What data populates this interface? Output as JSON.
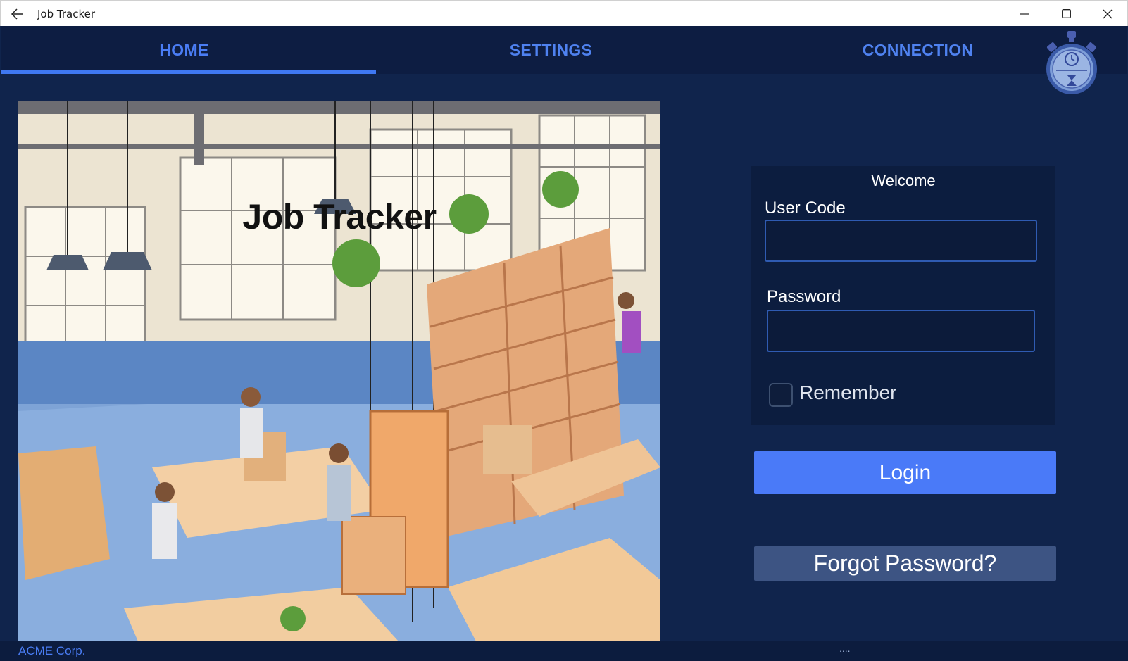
{
  "window": {
    "title": "Job Tracker",
    "back_icon": "back-arrow-icon",
    "controls": [
      "minimize-icon",
      "maximize-icon",
      "close-icon"
    ]
  },
  "tabs": [
    {
      "label": "HOME",
      "selected": true
    },
    {
      "label": "SETTINGS",
      "selected": false
    },
    {
      "label": "CONNECTION",
      "selected": false
    }
  ],
  "logo": {
    "icon": "stopwatch-icon"
  },
  "hero": {
    "title": "Job Tracker"
  },
  "login": {
    "welcome": "Welcome",
    "user_code_label": "User Code",
    "user_code_value": "",
    "password_label": "Password",
    "password_value": "",
    "remember_label": "Remember",
    "remember_checked": false,
    "login_button": "Login",
    "forgot_button": "Forgot Password?"
  },
  "status": {
    "text": "ACME Corp.",
    "grip": "...."
  },
  "colors": {
    "background": "#10244c",
    "accent": "#4a7af8",
    "nav": "#0d1d42",
    "secondary_button": "#3d5483"
  }
}
